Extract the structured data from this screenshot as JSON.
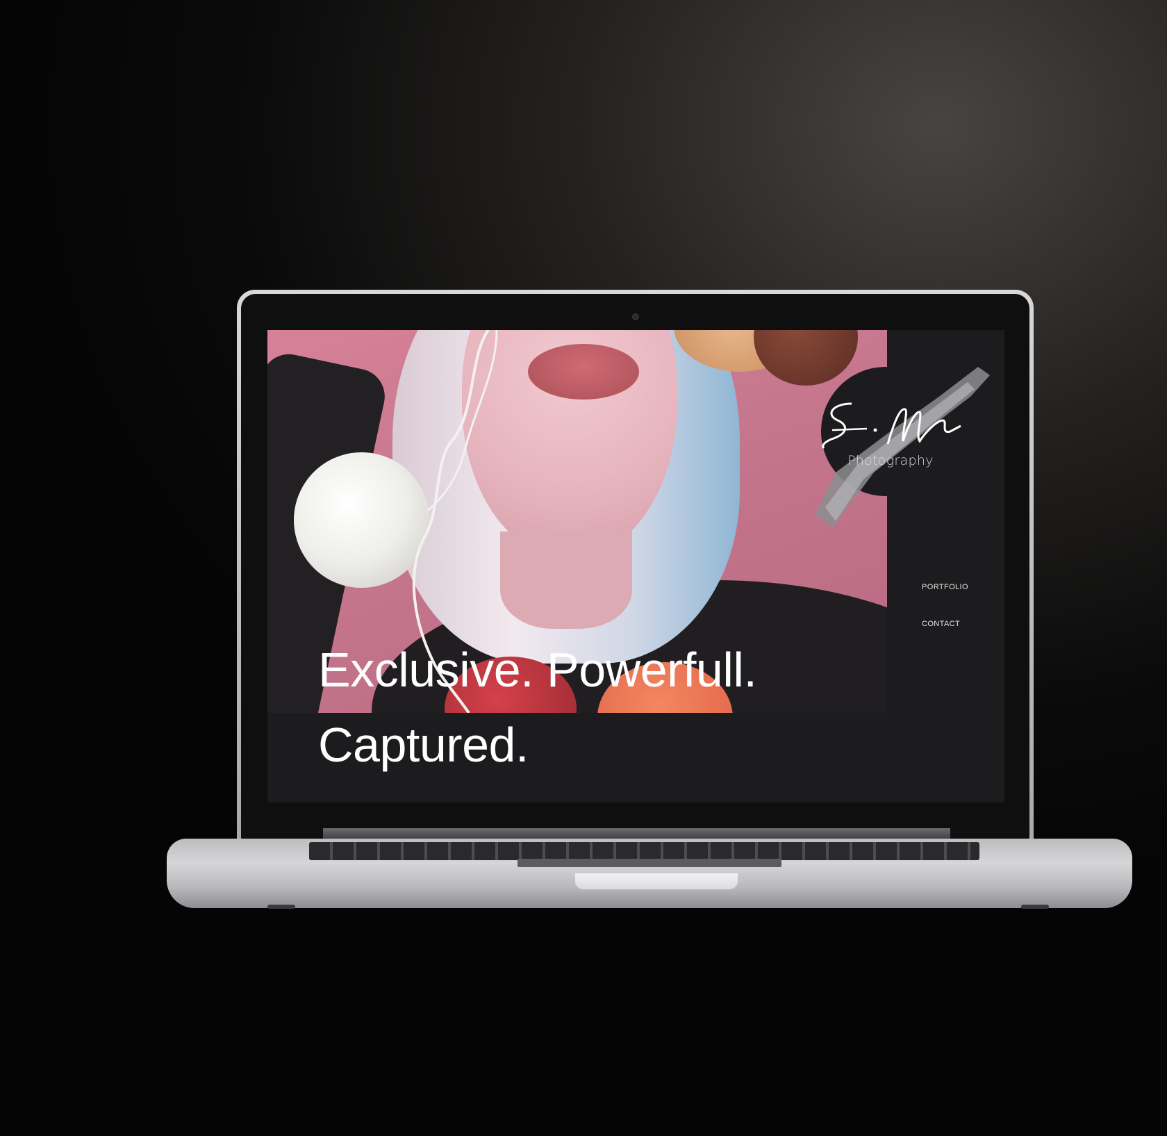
{
  "site": {
    "logo": {
      "monogram": "S.M",
      "subtitle": "Photography"
    },
    "nav": [
      {
        "label": "PORTFOLIO"
      },
      {
        "label": "CONTACT"
      }
    ],
    "headline": {
      "line1": "Exclusive. Powerfull.",
      "line2": "Captured."
    }
  },
  "colors": {
    "page_background": "#0b0b0b",
    "site_background": "#1c1c1e",
    "hero_pink": "#c5768d",
    "text": "#ffffff",
    "laptop_silver": "#c4c4c6"
  }
}
